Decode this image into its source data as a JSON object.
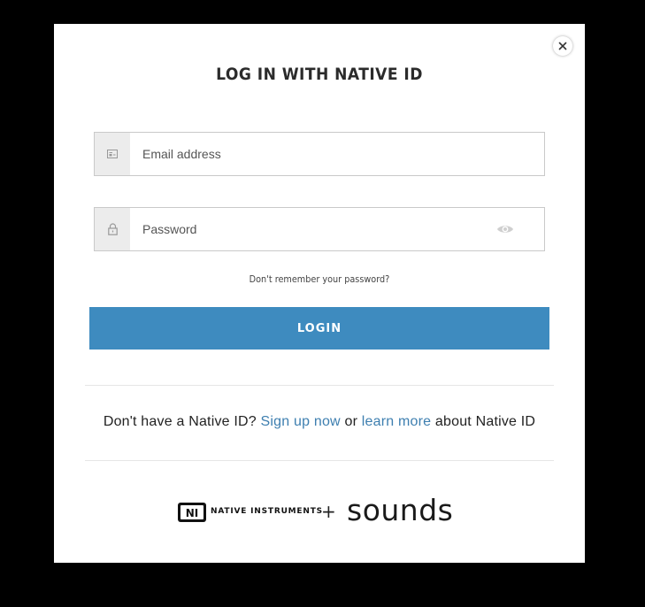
{
  "modal": {
    "title": "LOG IN WITH NATIVE ID",
    "close_icon": "close-icon"
  },
  "email": {
    "placeholder": "Email address",
    "value": "",
    "icon": "id-card-icon"
  },
  "password": {
    "placeholder": "Password",
    "value": "",
    "icon": "lock-icon",
    "toggle_icon": "eye-icon"
  },
  "forgot_label": "Don't remember your password?",
  "login_label": "LOGIN",
  "signup": {
    "prefix": "Don't have a Native ID?",
    "signup_link": "Sign up now",
    "middle": "or",
    "learn_link": "learn more",
    "suffix": "about Native ID"
  },
  "brands": {
    "ni_mark": "NI",
    "ni_name": "NATIVE INSTRUMENTS",
    "plus": "+",
    "sounds": "sounds"
  },
  "colors": {
    "accent": "#3e8bbf",
    "link": "#3e7fb0",
    "backdrop": "#000000"
  }
}
